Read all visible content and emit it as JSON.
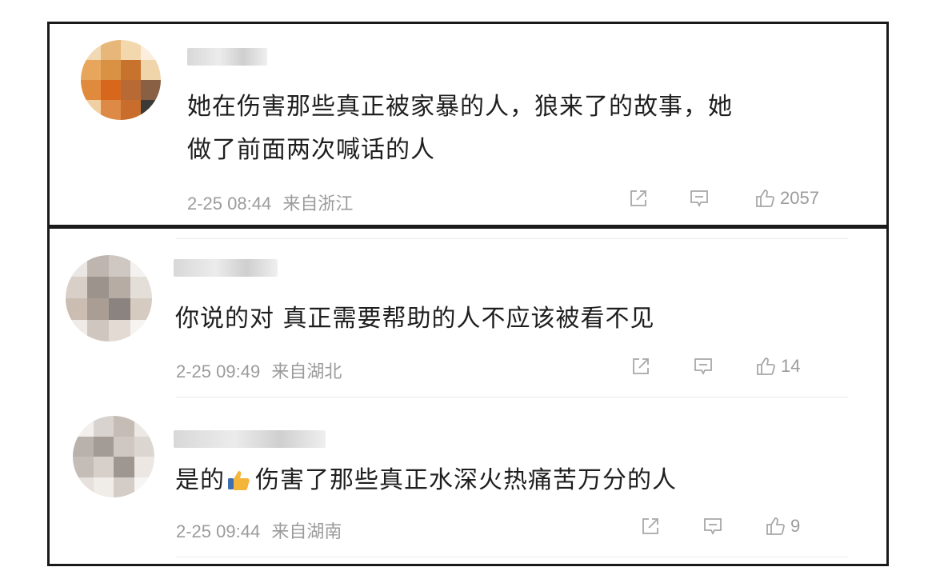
{
  "comments": [
    {
      "text_lines": [
        "她在伤害那些真正被家暴的人，狼来了的故事，她",
        "做了前面两次喊话的人"
      ],
      "timestamp": "2-25 08:44",
      "location": "来自浙江",
      "likes": "2057"
    },
    {
      "text": "你说的对 真正需要帮助的人不应该被看不见",
      "timestamp": "2-25 09:49",
      "location": "来自湖北",
      "likes": "14"
    },
    {
      "text_before": "是的",
      "emoji": "thumbs-up-emoji",
      "text_after": "伤害了那些真正水深火热痛苦万分的人",
      "timestamp": "2-25 09:44",
      "location": "来自湖南",
      "likes": "9"
    }
  ],
  "icons": {
    "share": "share-icon",
    "reply": "comment-icon",
    "like": "thumb-up-icon"
  },
  "colors": {
    "text": "#1f1f1f",
    "meta": "#9b9b9b",
    "border": "#1a1a1a"
  }
}
